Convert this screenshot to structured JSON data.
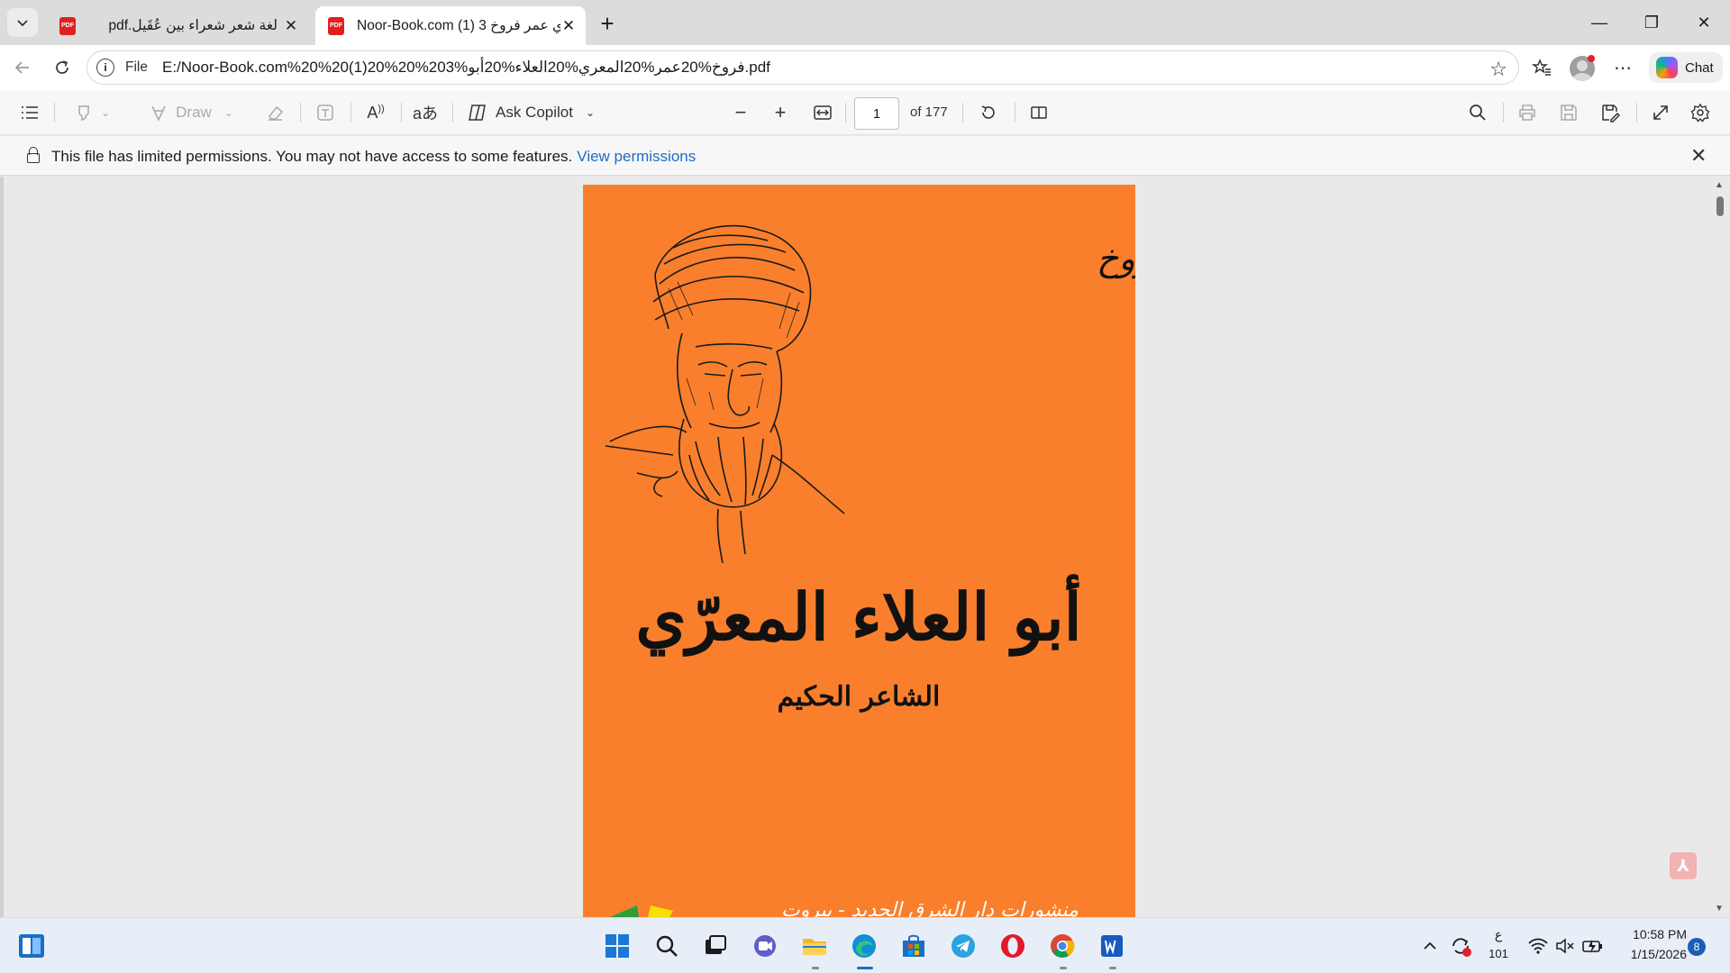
{
  "browser": {
    "tabs": [
      {
        "title": "لغة شعر شعراء بين عُقَيل.pdf",
        "active": false
      },
      {
        "title": "Noor-Book.com (1) 3 عري عمر فروخ",
        "active": true
      }
    ],
    "new_tab_symbol": "+",
    "window_controls": {
      "minimize": "—",
      "restore": "❐",
      "close": "✕"
    }
  },
  "address_bar": {
    "scheme_label": "File",
    "url": "E:/Noor-Book.com%20%20(1)20%20%203%فروخ%20عمر%20المعري%20العلاء%20أبو.pdf",
    "chat_label": "Chat"
  },
  "pdf_toolbar": {
    "draw_label": "Draw",
    "ask_copilot_label": "Ask Copilot",
    "page_number": "1",
    "page_total": "of 177"
  },
  "permission_bar": {
    "message": "This file has limited permissions. You may not have access to some features.",
    "link_text": "View permissions"
  },
  "cover": {
    "author": "عمر فرّوخ",
    "title": "أبو العلاء المعرّي",
    "subtitle": "الشاعر الحكيم",
    "publisher": "منشورات دار الشرق الجديد - بيروت",
    "background_color": "#f97f2c"
  },
  "taskbar": {
    "language_indicator": "ع",
    "language_sub": "101",
    "time": "10:58 PM",
    "date": "1/15/2026",
    "notification_count": "8"
  }
}
